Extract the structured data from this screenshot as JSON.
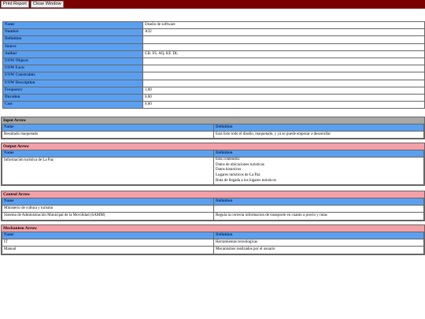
{
  "toolbar": {
    "print_label": "Print Report",
    "close_label": "Close Window"
  },
  "colors": {
    "titlebar": "#7a0000",
    "label_bg": "#5ba0f0",
    "input_head": "#a8a8a8",
    "output_head": "#f4a0a8"
  },
  "properties": [
    {
      "label": "Name",
      "value": "Diseño de software"
    },
    {
      "label": "Number",
      "value": "A32"
    },
    {
      "label": "Definition",
      "value": ""
    },
    {
      "label": "Source",
      "value": ""
    },
    {
      "label": "Author",
      "value": "GB. FS. AQ. KF. DL"
    },
    {
      "label": "UOW Objects",
      "value": ""
    },
    {
      "label": "UOW Facts",
      "value": ""
    },
    {
      "label": "UOW Constraints",
      "value": ""
    },
    {
      "label": "UOW Description",
      "value": ""
    },
    {
      "label": "Frequency",
      "value": "1,00"
    },
    {
      "label": "Duration",
      "value": "0,00"
    },
    {
      "label": "Cost",
      "value": "0,00"
    }
  ],
  "input": {
    "title": "Input Arrow",
    "col_name": "Name",
    "col_def": "Definition",
    "rows": [
      {
        "name": "Resultado maquetado",
        "def": "Está listo todo el diseño, maquetado, y ya se puede empezar a desarrollar"
      }
    ]
  },
  "output": {
    "title": "Output Arrow",
    "col_name": "Name",
    "col_def": "Definition",
    "rows": [
      {
        "name": "Información turística de La Paz",
        "def_lines": [
          "Esta contendra:",
          "Datos de ubicaciones turisticas",
          "Datos historicos",
          "Lugares turisticos de La Paz",
          "Ruta de llegada a los lugares turisticos"
        ]
      }
    ]
  },
  "control": {
    "title": "Control Arrow",
    "col_name": "Name",
    "col_def": "Definition",
    "rows": [
      {
        "name": "Ministerio de cultura y turismo",
        "def": ""
      },
      {
        "name": "Sistema de Administración Municipal de la Movilidad (SAMM)",
        "def": "Regula la correcta informacion de transporte en cuanto a precio y rutas"
      }
    ]
  },
  "mechanism": {
    "title": "Mechanism Arrow",
    "col_name": "Name",
    "col_def": "Definition",
    "rows": [
      {
        "name": "IT",
        "def": "Herramientas tecnologicas"
      },
      {
        "name": "Manual",
        "def": "Mecanismos realizados por el usuario"
      }
    ]
  }
}
